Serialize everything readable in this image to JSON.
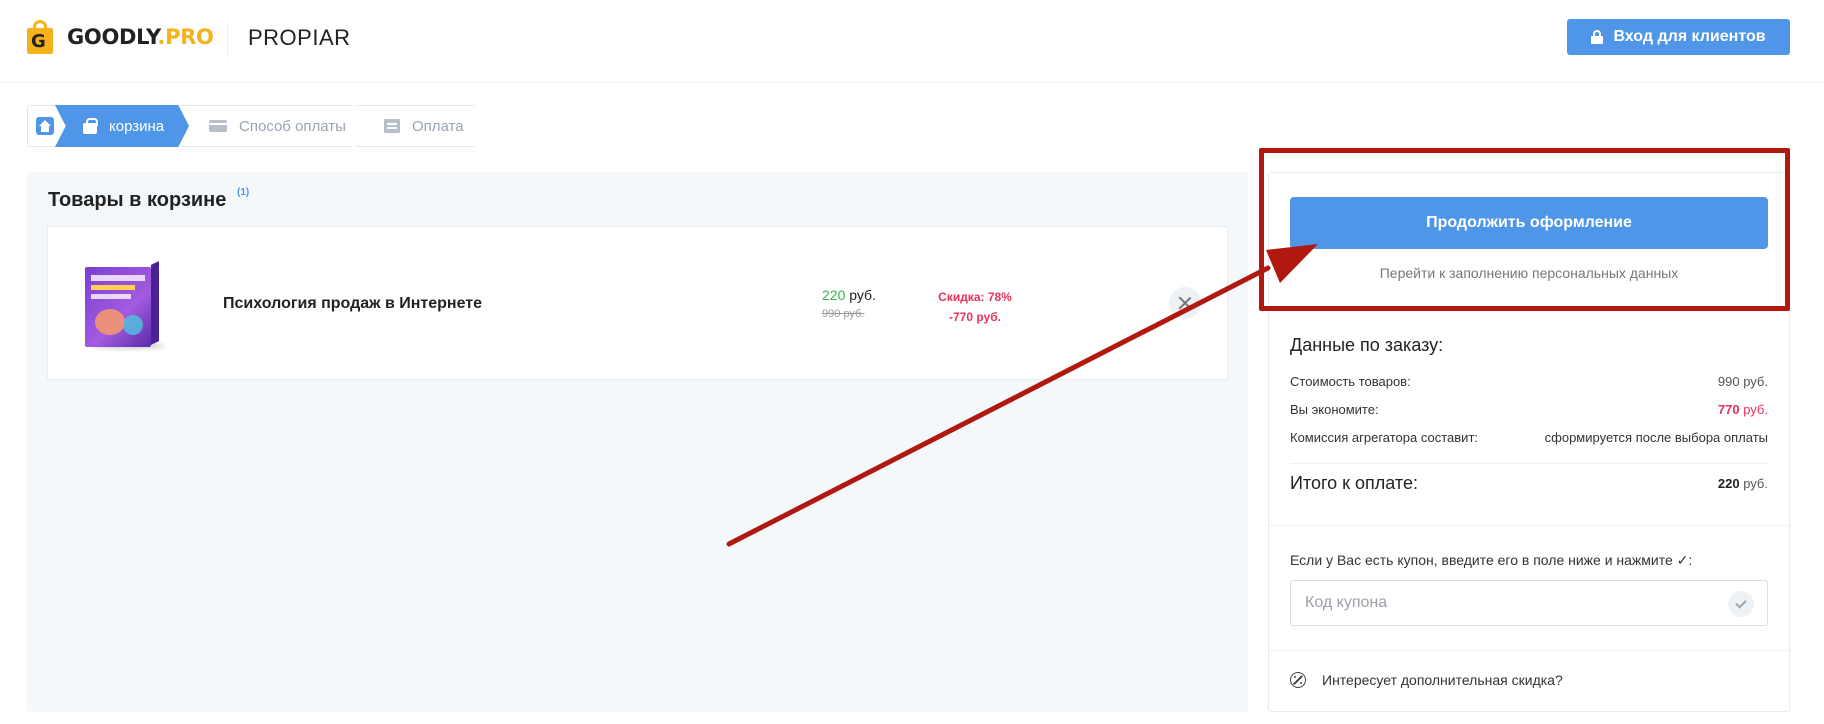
{
  "header": {
    "logo_main": "GOODLY",
    "logo_accent": ".PRO",
    "logo_letter": "G",
    "brand": "PROPIAR",
    "login_label": "Вход для клиентов"
  },
  "steps": [
    {
      "label": "корзина",
      "icon": "bag-icon",
      "active": true
    },
    {
      "label": "Способ оплаты",
      "icon": "card-icon",
      "active": false
    },
    {
      "label": "Оплата",
      "icon": "document-icon",
      "active": false
    }
  ],
  "cart": {
    "title": "Товары в корзине",
    "count": "(1)",
    "items": [
      {
        "name": "Психология продаж в Интернете",
        "price_now": "220",
        "currency": "руб.",
        "price_old": "990 руб.",
        "discount_pct": "Скидка: 78%",
        "discount_amount": "-770 руб."
      }
    ]
  },
  "summary": {
    "continue_label": "Продолжить оформление",
    "continue_hint": "Перейти к заполнению персональных данных",
    "order_title": "Данные по заказу:",
    "rows": [
      {
        "label": "Стоимость товаров:",
        "value": "990",
        "unit": "руб."
      },
      {
        "label": "Вы экономите:",
        "value": "770",
        "unit": "руб."
      },
      {
        "label": "Комиссия агрегатора составит:",
        "value": "сформируется после выбора оплаты"
      }
    ],
    "total_label": "Итого к оплате:",
    "total_value": "220",
    "total_unit": "руб.",
    "coupon_label": "Если у Вас есть купон, введите его в поле ниже и нажмите ✓:",
    "coupon_placeholder": "Код купона",
    "extra_discount": "Интересует дополнительная скидка?"
  },
  "colors": {
    "accent": "#4f96e9",
    "annotation": "#b1180f",
    "discount": "#e8315a",
    "price": "#3bb54a",
    "logo": "#f6b21b"
  }
}
